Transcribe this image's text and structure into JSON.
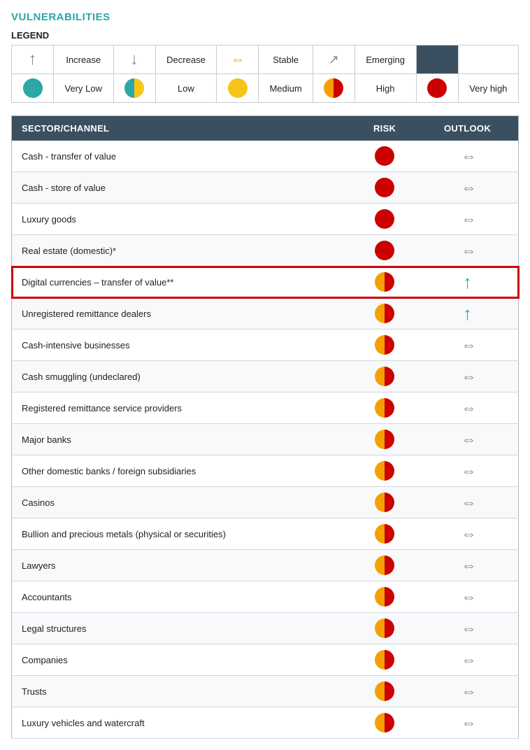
{
  "page": {
    "title": "VULNERABILITIES",
    "legend_title": "LEGEND",
    "legend_rows": [
      [
        {
          "type": "arrow-up",
          "label": "Increase"
        },
        {
          "type": "arrow-down",
          "label": "Decrease"
        },
        {
          "type": "arrow-stable",
          "label": "Stable"
        },
        {
          "type": "arrow-emerging",
          "label": "Emerging"
        },
        {
          "type": "dark-cell",
          "label": ""
        }
      ],
      [
        {
          "type": "circle-very-low",
          "label": "Very Low"
        },
        {
          "type": "circle-low",
          "label": "Low"
        },
        {
          "type": "circle-medium",
          "label": "Medium"
        },
        {
          "type": "circle-high",
          "label": "High"
        },
        {
          "type": "circle-very-high",
          "label": "Very high"
        }
      ]
    ],
    "table": {
      "headers": [
        "SECTOR/CHANNEL",
        "RISK",
        "OUTLOOK"
      ],
      "rows": [
        {
          "sector": "Cash - transfer of value",
          "risk": "very-high",
          "outlook": "stable",
          "highlighted": false
        },
        {
          "sector": "Cash - store of value",
          "risk": "very-high",
          "outlook": "stable",
          "highlighted": false
        },
        {
          "sector": "Luxury goods",
          "risk": "very-high",
          "outlook": "stable",
          "highlighted": false
        },
        {
          "sector": "Real estate (domestic)*",
          "risk": "very-high",
          "outlook": "stable",
          "highlighted": false
        },
        {
          "sector": "Digital currencies – transfer of value**",
          "risk": "high",
          "outlook": "increase",
          "highlighted": true
        },
        {
          "sector": "Unregistered remittance dealers",
          "risk": "high",
          "outlook": "increase",
          "highlighted": false
        },
        {
          "sector": "Cash-intensive businesses",
          "risk": "high",
          "outlook": "stable",
          "highlighted": false
        },
        {
          "sector": "Cash smuggling (undeclared)",
          "risk": "high",
          "outlook": "stable",
          "highlighted": false
        },
        {
          "sector": "Registered remittance service providers",
          "risk": "high",
          "outlook": "stable",
          "highlighted": false
        },
        {
          "sector": "Major banks",
          "risk": "high",
          "outlook": "stable",
          "highlighted": false
        },
        {
          "sector": "Other domestic banks / foreign subsidiaries",
          "risk": "high",
          "outlook": "stable",
          "highlighted": false
        },
        {
          "sector": "Casinos",
          "risk": "high",
          "outlook": "stable",
          "highlighted": false
        },
        {
          "sector": "Bullion and precious metals (physical or securities)",
          "risk": "high",
          "outlook": "stable",
          "highlighted": false
        },
        {
          "sector": "Lawyers",
          "risk": "high",
          "outlook": "stable",
          "highlighted": false
        },
        {
          "sector": "Accountants",
          "risk": "high",
          "outlook": "stable",
          "highlighted": false
        },
        {
          "sector": "Legal structures",
          "risk": "high",
          "outlook": "stable",
          "highlighted": false
        },
        {
          "sector": "Companies",
          "risk": "high",
          "outlook": "stable",
          "highlighted": false
        },
        {
          "sector": "Trusts",
          "risk": "high",
          "outlook": "stable",
          "highlighted": false
        },
        {
          "sector": "Luxury vehicles and watercraft",
          "risk": "high",
          "outlook": "stable",
          "highlighted": false
        }
      ]
    }
  }
}
